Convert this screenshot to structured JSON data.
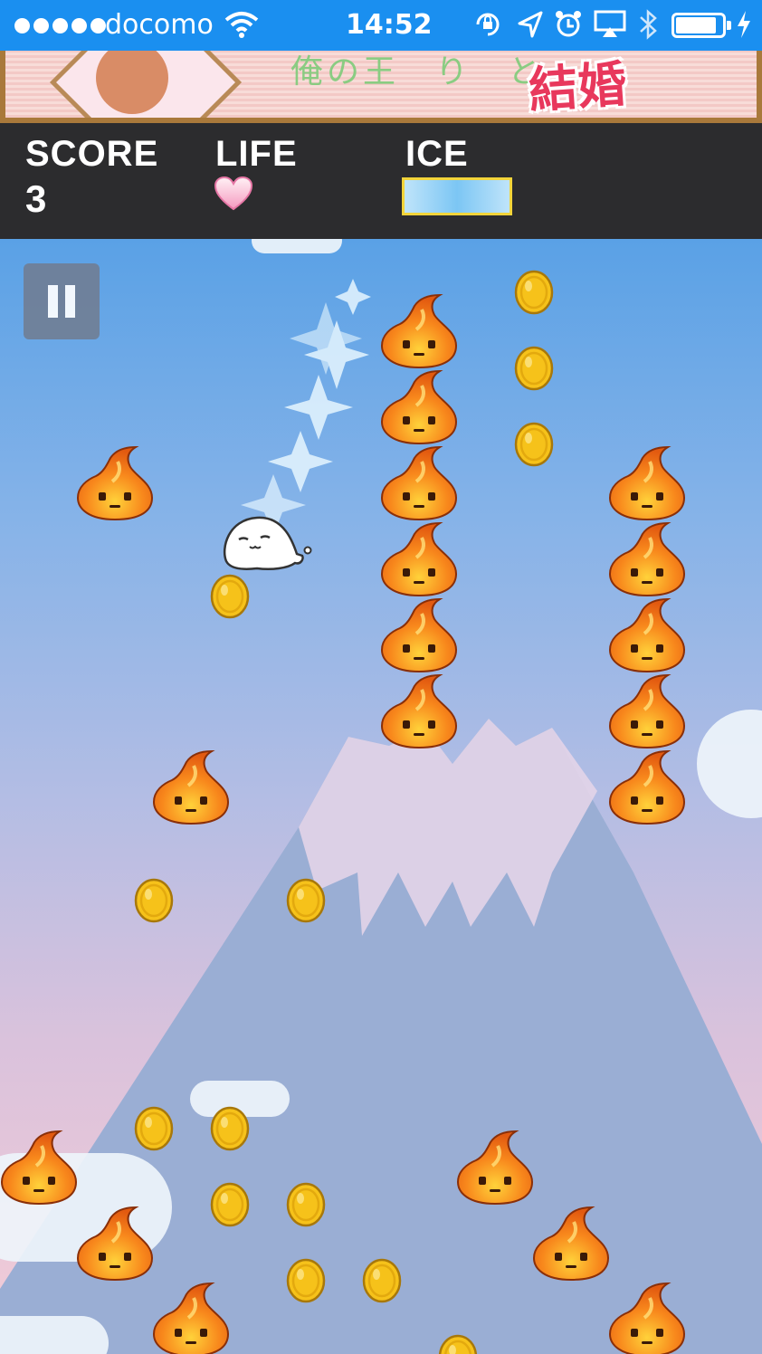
{
  "status_bar": {
    "carrier": "docomo",
    "time": "14:52",
    "icons": [
      "signal-dots-icon",
      "wifi-icon",
      "rotation-lock-icon",
      "location-arrow-icon",
      "alarm-icon",
      "airplay-icon",
      "bluetooth-icon",
      "battery-icon",
      "charging-bolt-icon"
    ]
  },
  "ad_banner": {
    "faded_text": "俺の王　り　と",
    "big_text": "結婚"
  },
  "hud": {
    "score_label": "SCORE",
    "score_value": "3",
    "life_label": "LIFE",
    "lives": 1,
    "ice_label": "ICE",
    "ice_level": 1.0
  },
  "game": {
    "pause_button": "pause-icon",
    "player": "white-seal-character",
    "colors": {
      "fire": "#f36a12",
      "coin": "#f6c21a",
      "hud_bg": "#2c2c2e",
      "ice_bar_border": "#f2d43a",
      "status_bar_bg": "#1a8ff0"
    }
  }
}
